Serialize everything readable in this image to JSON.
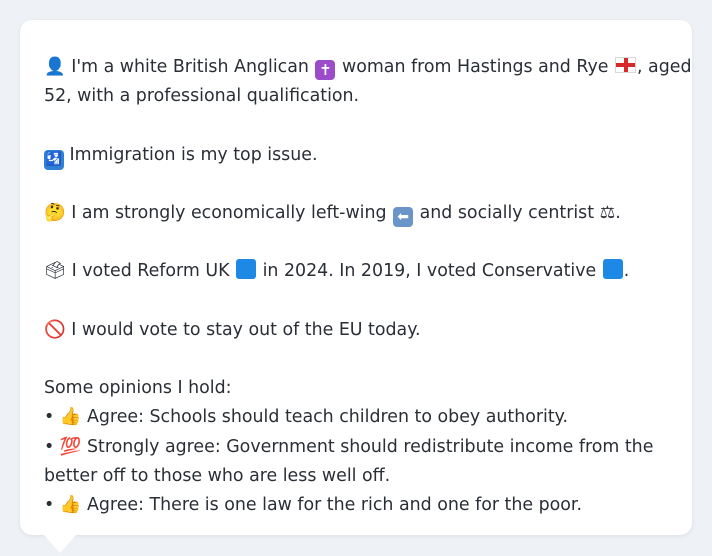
{
  "persona": {
    "identity_prefix": "I'm a white British Anglican",
    "identity_middle": "woman from Hastings and Rye",
    "identity_suffix": ", aged",
    "identity_line2": "52, with a professional qualification.",
    "top_issue": "Immigration is my top issue.",
    "economic_prefix": "I am strongly economically left-wing",
    "economic_middle": "and socially centrist",
    "economic_suffix": ".",
    "vote_prefix": "I voted Reform UK",
    "vote_middle": "in 2024. In 2019, I voted Conservative",
    "vote_suffix": ".",
    "eu_stance": "I would vote to stay out of the EU today.",
    "opinions_heading": "Some opinions I hold:",
    "opinions": [
      {
        "bullet": "•",
        "label": "Agree: Schools should teach children to obey authority."
      },
      {
        "bullet": "•",
        "label": "Strongly agree: Government should redistribute income from the better off to those who are less well off."
      },
      {
        "bullet": "•",
        "label": "Agree: There is one law for the rich and one for the poor."
      }
    ]
  },
  "icons": {
    "person": "👤",
    "cross": "✝",
    "flag": "england-flag",
    "migration": "🛂",
    "thinking": "🤔",
    "left_arrow": "⬅",
    "scales": "⚖",
    "ballot": "🗳",
    "blue_square": "🟦",
    "no_entry": "🚫",
    "thumbs_up": "👍",
    "hundred": "💯"
  },
  "colors": {
    "background": "#eef1f5",
    "bubble": "#ffffff",
    "text": "#2a2f36",
    "reform_square": "#1e88e5",
    "conservative_square": "#1e88e5"
  }
}
